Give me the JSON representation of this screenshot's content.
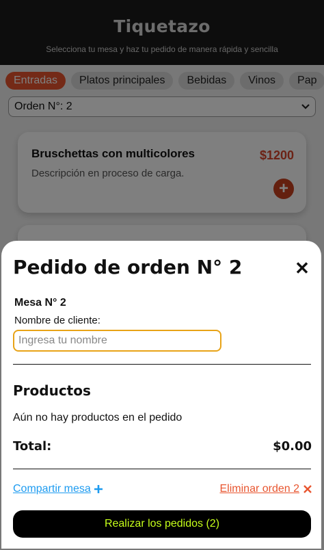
{
  "header": {
    "title": "Tiquetazo",
    "subtitle": "Selecciona tu mesa y haz tu pedido de manera rápida y sencilla"
  },
  "tabs": [
    {
      "label": "Entradas",
      "active": true
    },
    {
      "label": "Platos principales",
      "active": false
    },
    {
      "label": "Bebidas",
      "active": false
    },
    {
      "label": "Vinos",
      "active": false
    },
    {
      "label": "Pap",
      "active": false
    }
  ],
  "order_select": {
    "value": "Orden N°: 2",
    "icon": "chevron-down-icon"
  },
  "products": [
    {
      "name": "Bruschettas con multicolores",
      "price": "$1200",
      "description": "Descripción en proceso de carga.",
      "add_icon": "plus-circle-icon"
    }
  ],
  "modal": {
    "title": "Pedido de orden N° 2",
    "close_icon": "close-icon",
    "mesa": "Mesa N° 2",
    "client_label": "Nombre de cliente:",
    "client_placeholder": "Ingresa tu nombre",
    "client_value": "",
    "products_title": "Productos",
    "empty_message": "Aún no hay productos en el pedido",
    "total_label": "Total:",
    "total_value": "$0.00",
    "share_label": "Compartir mesa",
    "share_icon": "plus-icon",
    "delete_label": "Eliminar orden 2",
    "delete_icon": "close-icon",
    "submit_label": "Realizar los pedidos (2)"
  },
  "colors": {
    "accent": "#e8552f",
    "link": "#1d9bf0",
    "submit_text": "#c6ff1a",
    "input_border": "#e8a317"
  }
}
